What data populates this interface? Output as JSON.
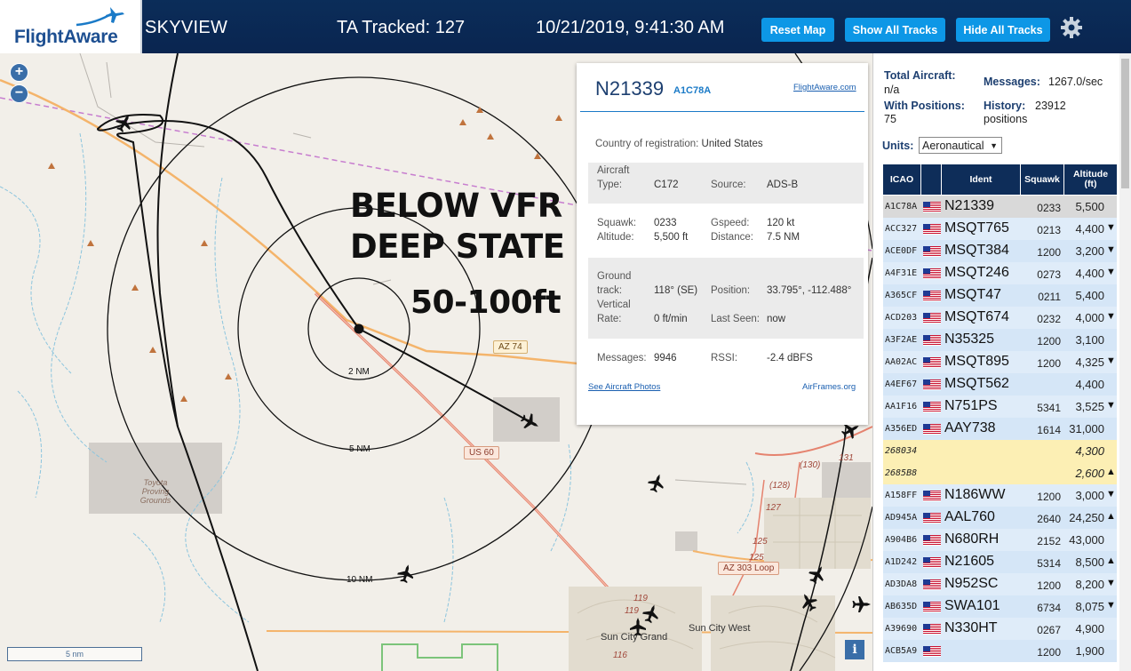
{
  "header": {
    "logo_text": "FlightAware",
    "app_title": "SKYVIEW",
    "tracked": "TA Tracked: 127",
    "datetime": "10/21/2019, 9:41:30 AM",
    "reset_map": "Reset Map",
    "show_all_tracks": "Show All Tracks",
    "hide_all_tracks": "Hide All Tracks"
  },
  "map": {
    "overlay_line1": "BELOW VFR",
    "overlay_line2": "DEEP STATE",
    "overlay_line3": "50-100ft",
    "rings": [
      "2 NM",
      "5 NM",
      "10 NM"
    ],
    "road_badges": [
      "AZ 74",
      "US 60",
      "AZ 303 Loop"
    ],
    "places": [
      "Sun City Grand",
      "Sun City West"
    ],
    "place_small": [
      "Toyota",
      "Proving",
      "Grounds"
    ],
    "route_numbers": [
      "(130)",
      "131",
      "(128)",
      "127",
      "125",
      "125",
      "119",
      "119",
      "116"
    ],
    "scale": "5 nm",
    "info_icon": "i"
  },
  "popup": {
    "registration": "N21339",
    "icao": "A1C78A",
    "flightaware_link": "FlightAware.com",
    "country_label": "Country of registration:",
    "country": "United States",
    "aircraft_type_label": "Aircraft Type:",
    "aircraft_type_label_1": "Aircraft",
    "aircraft_type_label_2": "Type:",
    "aircraft_type": "C172",
    "source_label": "Source:",
    "source": "ADS-B",
    "squawk_label": "Squawk:",
    "squawk": "0233",
    "gspeed_label": "Gspeed:",
    "gspeed": "120 kt",
    "altitude_label": "Altitude:",
    "altitude": "5,500 ft",
    "distance_label": "Distance:",
    "distance": "7.5 NM",
    "ground_track_label_1": "Ground",
    "ground_track_label_2": "track:",
    "ground_track": "118° (SE)",
    "position_label": "Position:",
    "position": "33.795°, -112.488°",
    "vertical_rate_label_1": "Vertical",
    "vertical_rate_label_2": "Rate:",
    "vertical_rate": "0 ft/min",
    "last_seen_label": "Last Seen:",
    "last_seen": "now",
    "messages_label": "Messages:",
    "messages": "9946",
    "rssi_label": "RSSI:",
    "rssi": "-2.4 dBFS",
    "photos_link": "See Aircraft Photos",
    "airframes_link": "AirFrames.org"
  },
  "sidebar": {
    "total_aircraft_label": "Total Aircraft:",
    "total_aircraft": "n/a",
    "messages_label": "Messages:",
    "messages": "1267.0/sec",
    "with_positions_label": "With Positions:",
    "with_positions": "75",
    "history_label": "History:",
    "history_value": "23912",
    "history_unit": "positions",
    "units_label": "Units:",
    "units_value": "Aeronautical",
    "columns": [
      "ICAO",
      "Ident",
      "Squawk",
      "Altitude (ft)"
    ],
    "col_alt_1": "Altitude",
    "col_alt_2": "(ft)",
    "rows": [
      {
        "icao": "A1C78A",
        "flag": true,
        "ident": "N21339",
        "squawk": "0233",
        "alt": "5,500",
        "arrow": "",
        "state": "sel"
      },
      {
        "icao": "ACC327",
        "flag": true,
        "ident": "MSQT765",
        "squawk": "0213",
        "alt": "4,400",
        "arrow": "▼",
        "state": ""
      },
      {
        "icao": "ACE0DF",
        "flag": true,
        "ident": "MSQT384",
        "squawk": "1200",
        "alt": "3,200",
        "arrow": "▼",
        "state": ""
      },
      {
        "icao": "A4F31E",
        "flag": true,
        "ident": "MSQT246",
        "squawk": "0273",
        "alt": "4,400",
        "arrow": "▼",
        "state": ""
      },
      {
        "icao": "A365CF",
        "flag": true,
        "ident": "MSQT47",
        "squawk": "0211",
        "alt": "5,400",
        "arrow": "",
        "state": ""
      },
      {
        "icao": "ACD203",
        "flag": true,
        "ident": "MSQT674",
        "squawk": "0232",
        "alt": "4,000",
        "arrow": "▼",
        "state": ""
      },
      {
        "icao": "A3F2AE",
        "flag": true,
        "ident": "N35325",
        "squawk": "1200",
        "alt": "3,100",
        "arrow": "",
        "state": ""
      },
      {
        "icao": "AA02AC",
        "flag": true,
        "ident": "MSQT895",
        "squawk": "1200",
        "alt": "4,325",
        "arrow": "▼",
        "state": ""
      },
      {
        "icao": "A4EF67",
        "flag": true,
        "ident": "MSQT562",
        "squawk": "",
        "alt": "4,400",
        "arrow": "",
        "state": ""
      },
      {
        "icao": "AA1F16",
        "flag": true,
        "ident": "N751PS",
        "squawk": "5341",
        "alt": "3,525",
        "arrow": "▼",
        "state": ""
      },
      {
        "icao": "A356ED",
        "flag": true,
        "ident": "AAY738",
        "squawk": "1614",
        "alt": "31,000",
        "arrow": "",
        "state": ""
      },
      {
        "icao": "268034",
        "flag": false,
        "ident": "",
        "squawk": "",
        "alt": "4,300",
        "arrow": "",
        "state": "yellow"
      },
      {
        "icao": "2685B8",
        "flag": false,
        "ident": "",
        "squawk": "",
        "alt": "2,600",
        "arrow": "▲",
        "state": "yellow"
      },
      {
        "icao": "A158FF",
        "flag": true,
        "ident": "N186WW",
        "squawk": "1200",
        "alt": "3,000",
        "arrow": "▼",
        "state": ""
      },
      {
        "icao": "AD945A",
        "flag": true,
        "ident": "AAL760",
        "squawk": "2640",
        "alt": "24,250",
        "arrow": "▲",
        "state": ""
      },
      {
        "icao": "A904B6",
        "flag": true,
        "ident": "N680RH",
        "squawk": "2152",
        "alt": "43,000",
        "arrow": "",
        "state": ""
      },
      {
        "icao": "A1D242",
        "flag": true,
        "ident": "N21605",
        "squawk": "5314",
        "alt": "8,500",
        "arrow": "▲",
        "state": ""
      },
      {
        "icao": "AD3DA8",
        "flag": true,
        "ident": "N952SC",
        "squawk": "1200",
        "alt": "8,200",
        "arrow": "▼",
        "state": ""
      },
      {
        "icao": "AB635D",
        "flag": true,
        "ident": "SWA101",
        "squawk": "6734",
        "alt": "8,075",
        "arrow": "▼",
        "state": ""
      },
      {
        "icao": "A39690",
        "flag": true,
        "ident": "N330HT",
        "squawk": "0267",
        "alt": "4,900",
        "arrow": "",
        "state": ""
      },
      {
        "icao": "ACB5A9",
        "flag": true,
        "ident": "",
        "squawk": "1200",
        "alt": "1,900",
        "arrow": "",
        "state": ""
      }
    ]
  }
}
